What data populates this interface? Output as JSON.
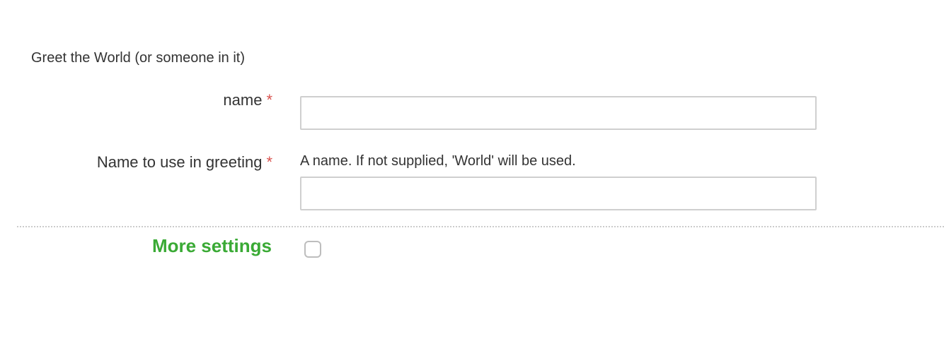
{
  "form": {
    "title": "Greet the World (or someone in it)",
    "fields": [
      {
        "label": "name",
        "required_mark": "*",
        "value": "",
        "placeholder": ""
      },
      {
        "label": "Name to use in greeting",
        "required_mark": "*",
        "help_text": "A name. If not supplied, 'World' will be used.",
        "value": "",
        "placeholder": ""
      }
    ],
    "more_settings": {
      "label": "More settings",
      "checked": false
    }
  },
  "colors": {
    "required": "#d9534f",
    "more_settings": "#3aaa35",
    "text": "#333333",
    "input_border": "#cfcfcf"
  }
}
